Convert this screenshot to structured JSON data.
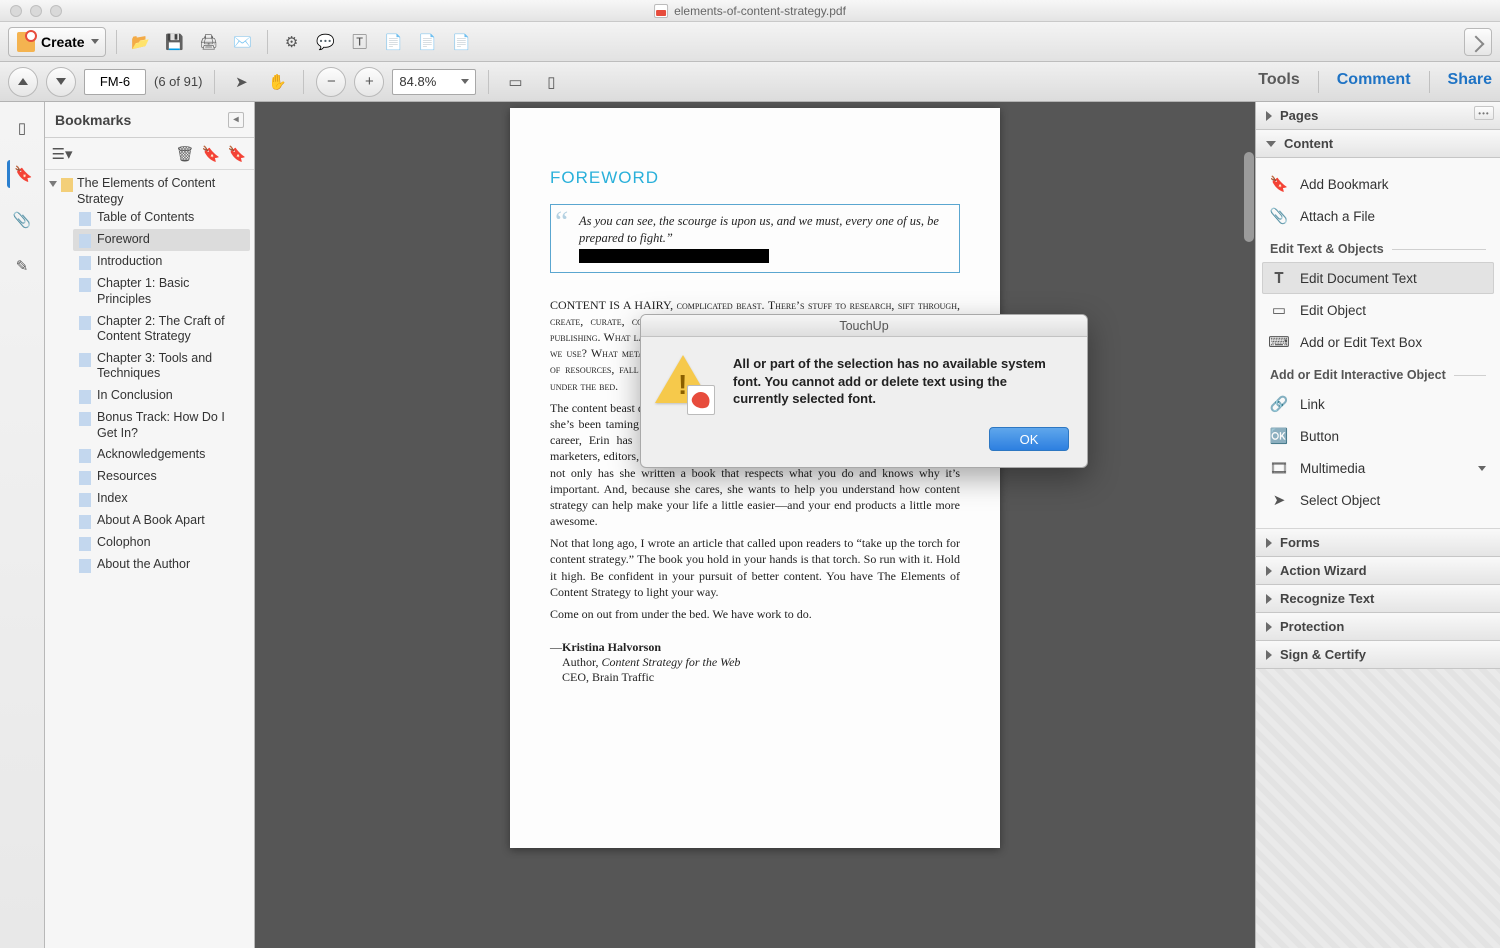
{
  "window": {
    "filename": "elements-of-content-strategy.pdf"
  },
  "toolbar": {
    "create_label": "Create"
  },
  "nav": {
    "page_label": "FM-6",
    "page_count": "(6 of 91)",
    "zoom": "84.8%",
    "tools_label": "Tools",
    "comment_label": "Comment",
    "share_label": "Share"
  },
  "bookmarks_panel": {
    "title": "Bookmarks",
    "root": "The Elements of Content Strategy",
    "items": [
      "Table of Contents",
      "Foreword",
      "Introduction",
      "Chapter 1: Basic Principles",
      "Chapter 2: The Craft of Content Strategy",
      "Chapter 3: Tools and Techniques",
      "In Conclusion",
      "Bonus Track: How Do I Get In?",
      "Acknowledgements",
      "Resources",
      "Index",
      "About A Book Apart",
      "Colophon",
      "About the Author"
    ],
    "selected_index": 1
  },
  "page": {
    "heading": "FOREWORD",
    "quote": "As you can see, the scourge is upon us, and we must, every one of us, be prepared to fight.”",
    "p1": "CONTENT IS A HAIRY, complicated beast. There’s stuff to research, sift through, create, curate, correct, schedule—and that’s before we start to think about publishing. What layout makes the most sense for this content? What formats should we use? What metaschema? What processes? Suddenly, your content plans, or lack of resources, fall apart. You freeze. Panic sets in, or…yikes. No wonder we hide under the bed.",
    "p2": "The content beast doesn’t scare Erin Kissane. A writer and editor her entire adult life, she’s been taming the beast with a firm but gentle hand. As part of her illustrious career, Erin has collaborated with countless designers, developers, researchers, marketers, editors, and writers. She gets what you do. And that is good news for you: not only has she written a book that respects what you do and knows why it’s important. And, because she cares, she wants to help you understand how content strategy can help make your life a little easier—and your end products a little more awesome.",
    "p3": "Not that long ago, I wrote an article that called upon readers to “take up the torch for content strategy.” The book you hold in your hands is that torch. So run with it. Hold it high. Be confident in your pursuit of better content. You have The Elements of Content Strategy to light your way.",
    "p4": "Come on out from under the bed. We have work to do.",
    "sig_name": "Kristina Halvorson",
    "sig_line2a": "Author, ",
    "sig_line2b": "Content Strategy for the Web",
    "sig_line3": "CEO, Brain Traffic"
  },
  "tools_pane": {
    "sections": [
      "Pages",
      "Content",
      "Forms",
      "Action Wizard",
      "Recognize Text",
      "Protection",
      "Sign & Certify"
    ],
    "content": {
      "add_bookmark": "Add Bookmark",
      "attach_file": "Attach a File",
      "sec_edit": "Edit Text & Objects",
      "edit_doc_text": "Edit Document Text",
      "edit_object": "Edit Object",
      "add_text_box": "Add or Edit Text Box",
      "sec_interactive": "Add or Edit Interactive Object",
      "link": "Link",
      "button": "Button",
      "multimedia": "Multimedia",
      "select_object": "Select Object"
    }
  },
  "dialog": {
    "title": "TouchUp",
    "message": "All or part of the selection has no available system font. You cannot add or delete text using the currently selected font.",
    "ok": "OK"
  }
}
